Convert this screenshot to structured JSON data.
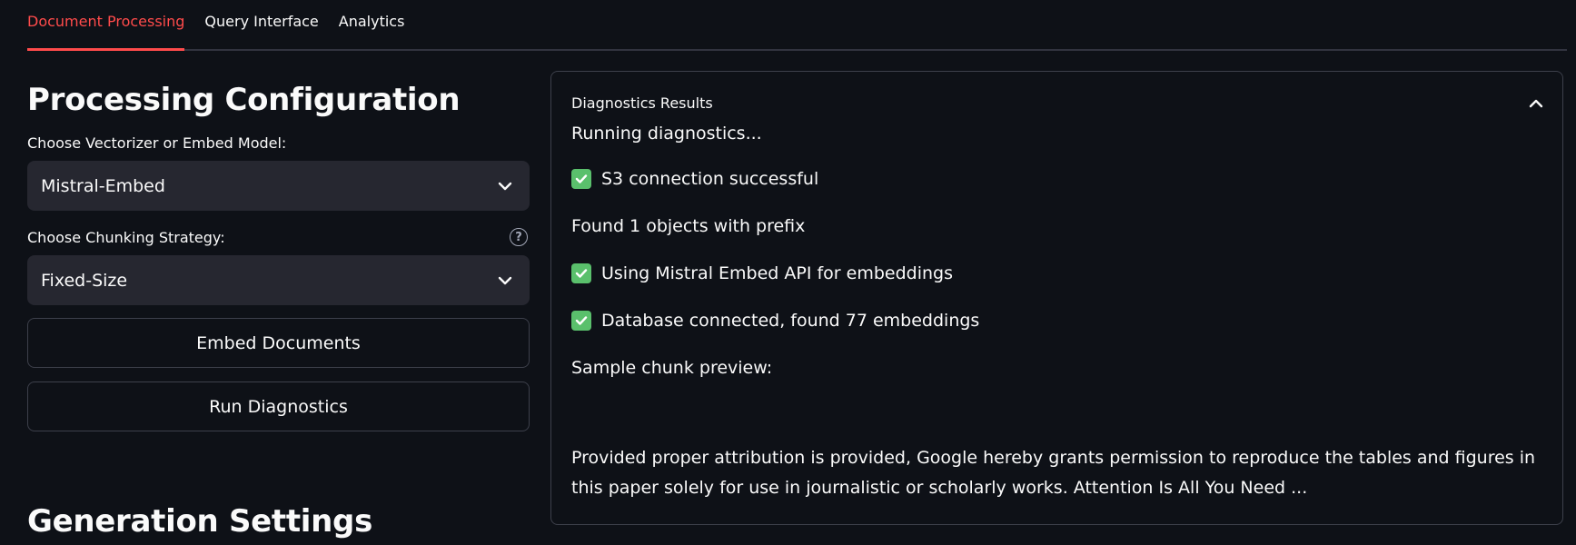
{
  "tabs": [
    {
      "label": "Document Processing",
      "active": true
    },
    {
      "label": "Query Interface",
      "active": false
    },
    {
      "label": "Analytics",
      "active": false
    }
  ],
  "left": {
    "heading": "Processing Configuration",
    "vectorizer": {
      "label": "Choose Vectorizer or Embed Model:",
      "value": "Mistral-Embed"
    },
    "chunking": {
      "label": "Choose Chunking Strategy:",
      "value": "Fixed-Size",
      "help_icon": "question-circle-icon"
    },
    "embed_button": "Embed Documents",
    "diagnostics_button": "Run Diagnostics",
    "generation_heading": "Generation Settings"
  },
  "diagnostics": {
    "title": "Diagnostics Results",
    "expanded": true,
    "lines": [
      {
        "text": "Running diagnostics...",
        "check": false
      },
      {
        "text": "S3 connection successful",
        "check": true
      },
      {
        "text": "Found 1 objects with prefix",
        "check": false
      },
      {
        "text": "Using Mistral Embed API for embeddings",
        "check": true
      },
      {
        "text": "Database connected, found 77 embeddings",
        "check": true
      },
      {
        "text": "Sample chunk preview:",
        "check": false
      }
    ],
    "preview": "Provided proper attribution is provided, Google hereby grants permission to reproduce the tables and figures in this paper solely for use in journalistic or scholarly works. Attention Is All You Need ..."
  },
  "colors": {
    "background": "#0e1117",
    "accent": "#ff4b4b",
    "check": "#5ac06c",
    "input_bg": "#262730"
  }
}
